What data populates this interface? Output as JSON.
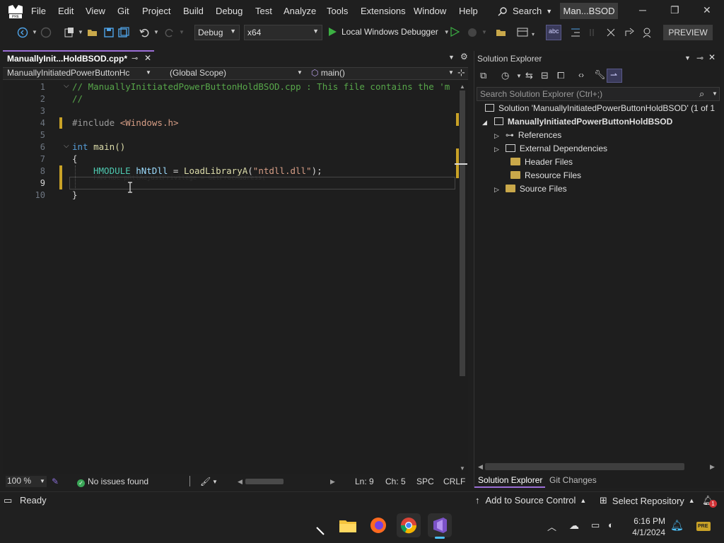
{
  "menu": {
    "items": [
      "File",
      "Edit",
      "View",
      "Git",
      "Project",
      "Build",
      "Debug",
      "Test",
      "Analyze",
      "Tools",
      "Extensions",
      "Window",
      "Help"
    ],
    "search_label": "Search",
    "window_title": "Man...BSOD"
  },
  "toolbar": {
    "configuration": "Debug",
    "platform": "x64",
    "debugger_label": "Local Windows Debugger",
    "preview_label": "PREVIEW"
  },
  "editor": {
    "tab_title": "ManuallyInit...HoldBSOD.cpp*",
    "nav_project": "ManuallyInitiatedPowerButtonHc",
    "nav_scope": "(Global Scope)",
    "nav_member": "main()",
    "line_numbers": [
      "1",
      "2",
      "3",
      "4",
      "5",
      "6",
      "7",
      "8",
      "9",
      "10"
    ],
    "code": {
      "l1": "// ManuallyInitiatedPowerButtonHoldBSOD.cpp : This file contains the 'm",
      "l2": "//",
      "l4_directive": "#include ",
      "l4_header": "<Windows.h>",
      "l6_kw": "int",
      "l6_fn": " main()",
      "l7": "{",
      "l8_type": "HMODULE",
      "l8_var": " hNtDll",
      "l8_eq": " = ",
      "l8_fn": "LoadLibraryA",
      "l8_p1": "(",
      "l8_str": "\"ntdll.dll\"",
      "l8_end": ");",
      "l9_ghost": "FARPROC pRtlAdjustPrivilege = GetProcAddress(",
      "l10": "}"
    }
  },
  "editor_status": {
    "zoom": "100 %",
    "issues": "No issues found",
    "line": "Ln: 9",
    "column": "Ch: 5",
    "whitespace": "SPC",
    "line_ending": "CRLF"
  },
  "solution_explorer": {
    "title": "Solution Explorer",
    "search_placeholder": "Search Solution Explorer (Ctrl+;)",
    "solution": "Solution 'ManuallyInitiatedPowerButtonHoldBSOD' (1 of 1",
    "project": "ManuallyInitiatedPowerButtonHoldBSOD",
    "nodes": [
      "References",
      "External Dependencies",
      "Header Files",
      "Resource Files",
      "Source Files"
    ],
    "tabs": [
      "Solution Explorer",
      "Git Changes"
    ]
  },
  "statusbar": {
    "ready": "Ready",
    "source_control": "Add to Source Control",
    "repository": "Select Repository",
    "notifications": "1"
  },
  "taskbar": {
    "time": "6:16 PM",
    "date": "4/1/2024"
  },
  "colors": {
    "accent": "#9b6ed6",
    "modified_marker": "#c9a227",
    "ok_green": "#3aa657",
    "play_green": "#3cb043"
  }
}
